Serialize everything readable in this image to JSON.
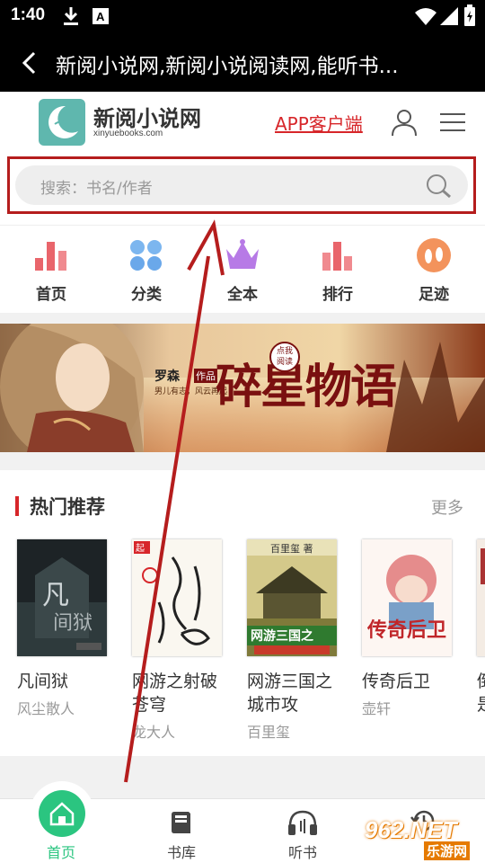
{
  "status_bar": {
    "time": "1:40",
    "icons": [
      "download-icon",
      "a-box-icon",
      "wifi-icon",
      "signal-icon",
      "battery-icon"
    ]
  },
  "title_bar": {
    "title": "新阅小说网,新阅小说阅读网,能听书..."
  },
  "header": {
    "logo_name": "新阅小说网",
    "logo_domain": "xinyuebooks.com",
    "app_link": "APP客户端"
  },
  "search": {
    "placeholder": "搜索：书名/作者"
  },
  "nav": [
    {
      "label": "首页",
      "icon": "bar-chart-icon",
      "color": "#e9656b"
    },
    {
      "label": "分类",
      "icon": "grid-dots-icon",
      "color": "#6aa8ea"
    },
    {
      "label": "全本",
      "icon": "crown-icon",
      "color": "#b77ae6"
    },
    {
      "label": "排行",
      "icon": "ranking-icon",
      "color": "#e9656b"
    },
    {
      "label": "足迹",
      "icon": "footprint-icon",
      "color": "#f3935c"
    }
  ],
  "banner": {
    "title": "碎星物语",
    "author": "罗森",
    "badge": "点我阅读",
    "slogan": "男儿有志，风云再起",
    "tag": "作品"
  },
  "hot": {
    "title": "热门推荐",
    "more": "更多",
    "books": [
      {
        "name": "凡间狱",
        "author": "风尘散人"
      },
      {
        "name": "网游之射破苍穹",
        "author": "龙大人"
      },
      {
        "name": "网游三国之城市攻",
        "author": "百里玺"
      },
      {
        "name": "传奇后卫",
        "author": "壶轩"
      },
      {
        "name": "倒是",
        "author": ""
      }
    ]
  },
  "tabbar": {
    "items": [
      {
        "label": "首页",
        "icon": "home-icon"
      },
      {
        "label": "书库",
        "icon": "book-icon"
      },
      {
        "label": "听书",
        "icon": "headphones-icon"
      },
      {
        "label": "",
        "icon": "history-icon"
      }
    ]
  },
  "watermark": {
    "text": "962.NET",
    "sub": "乐游网"
  },
  "colors": {
    "accent": "#d7262a",
    "home_green": "#2bc580",
    "logo_teal": "#5fb7ae",
    "annotation_red": "#b51d1d"
  }
}
